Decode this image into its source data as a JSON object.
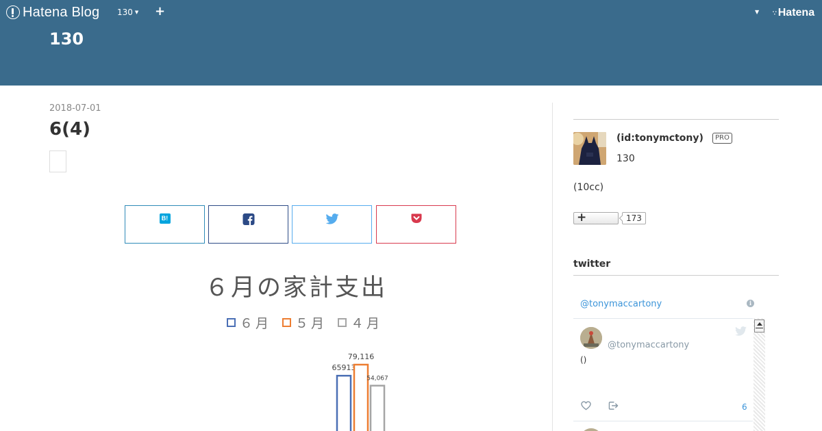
{
  "header": {
    "logo_text": "Hatena Blog",
    "blog_selector": "130",
    "add_symbol": "+",
    "hatena_label": "Hatena",
    "blog_title": "130",
    "background_color": "#3a6b8c"
  },
  "entry": {
    "date": "2018-07-01",
    "title": "6(4)"
  },
  "share": {
    "hatena_icon": "B!",
    "colors": {
      "hatena": "#2e8ab8",
      "facebook": "#2c4a86",
      "twitter": "#55acee",
      "pocket": "#d8394d"
    }
  },
  "chart": {
    "title": "６月の家計支出",
    "legend": [
      {
        "label": "６月",
        "color": "#4a6fb5"
      },
      {
        "label": "５月",
        "color": "#ed7d31"
      },
      {
        "label": "４月",
        "color": "#a5a5a5"
      }
    ]
  },
  "chart_data": {
    "type": "bar",
    "title": "６月の家計支出",
    "series": [
      {
        "name": "６月",
        "values": [
          65913
        ],
        "data_label": "65913",
        "color": "#4a6fb5"
      },
      {
        "name": "５月",
        "values": [
          79116
        ],
        "data_label": "79,116",
        "color": "#ed7d31"
      },
      {
        "name": "４月",
        "values": [
          54067
        ],
        "data_label": "54,067",
        "color": "#a5a5a5"
      }
    ],
    "legend_position": "top"
  },
  "sidebar": {
    "profile": {
      "name": "(id:tonymctony)",
      "badge": "PRO",
      "blog_name": "130",
      "description": "(10cc)",
      "reader_plus": "+",
      "reader_count": "173"
    },
    "twitter": {
      "heading": "twitter",
      "handle": "@tonymaccartony",
      "info_icon": "i",
      "tweet": {
        "author": "@tonymaccartony",
        "text": "()",
        "count": "6"
      }
    }
  }
}
